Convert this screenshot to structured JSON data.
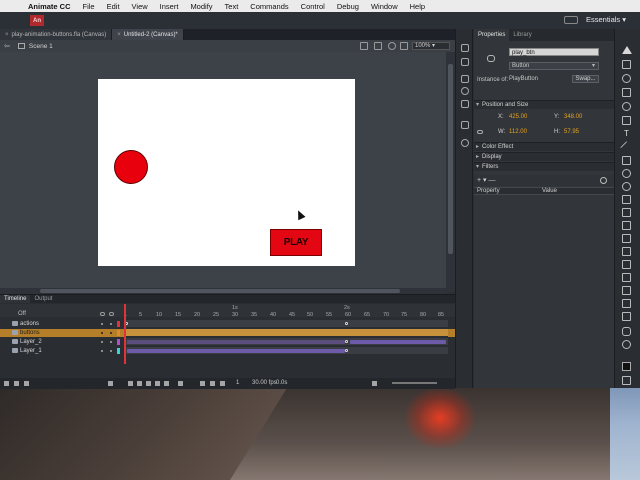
{
  "menubar": {
    "app_name": "Animate CC",
    "items": [
      "File",
      "Edit",
      "View",
      "Insert",
      "Modify",
      "Text",
      "Commands",
      "Control",
      "Debug",
      "Window",
      "Help"
    ],
    "workspace": "Essentials"
  },
  "app": {
    "logo": "An"
  },
  "doc_tabs": [
    {
      "label": "play-animation-buttons.fla (Canvas)",
      "active": false
    },
    {
      "label": "Untitled-2 (Canvas)*",
      "active": true
    }
  ],
  "stage_header": {
    "scene": "Scene 1",
    "zoom": "100%"
  },
  "stage": {
    "circle_color": "#e8000d",
    "button_color": "#e30613",
    "button_label": "PLAY"
  },
  "timeline": {
    "tabs": [
      "Timeline",
      "Output"
    ],
    "ruler_labels": [
      "1s",
      "2s"
    ],
    "frame_numbers": [
      "1",
      "5",
      "10",
      "15",
      "20",
      "25",
      "30",
      "35",
      "40",
      "45",
      "50",
      "55",
      "60",
      "65",
      "70",
      "75",
      "80",
      "85"
    ],
    "onion": "Off",
    "layers": [
      {
        "name": "actions",
        "selected": false,
        "color": "#e0343a"
      },
      {
        "name": "buttons",
        "selected": true,
        "color": "#e08a2a"
      },
      {
        "name": "Layer_2",
        "selected": false,
        "color": "#b04fc9"
      },
      {
        "name": "Layer_1",
        "selected": false,
        "color": "#3ad0d6"
      }
    ],
    "footer": {
      "frame": "1",
      "fps": "30.00 fps",
      "time": "0.0s"
    }
  },
  "properties": {
    "tabs": [
      "Properties",
      "Library"
    ],
    "instance_name": "play_btn",
    "symbol_type": "Button",
    "instance_of_label": "Instance of:",
    "instance_of": "PlayButton",
    "swap_label": "Swap...",
    "position_section": "Position and Size",
    "x_label": "X:",
    "x": "425.00",
    "y_label": "Y:",
    "y": "348.00",
    "w_label": "W:",
    "w": "112.00",
    "h_label": "H:",
    "h": "57.95",
    "color_effect": "Color Effect",
    "display": "Display",
    "filters": "Filters",
    "filters_add": "+ ▾ —",
    "filters_cols": [
      "Property",
      "Value"
    ]
  }
}
